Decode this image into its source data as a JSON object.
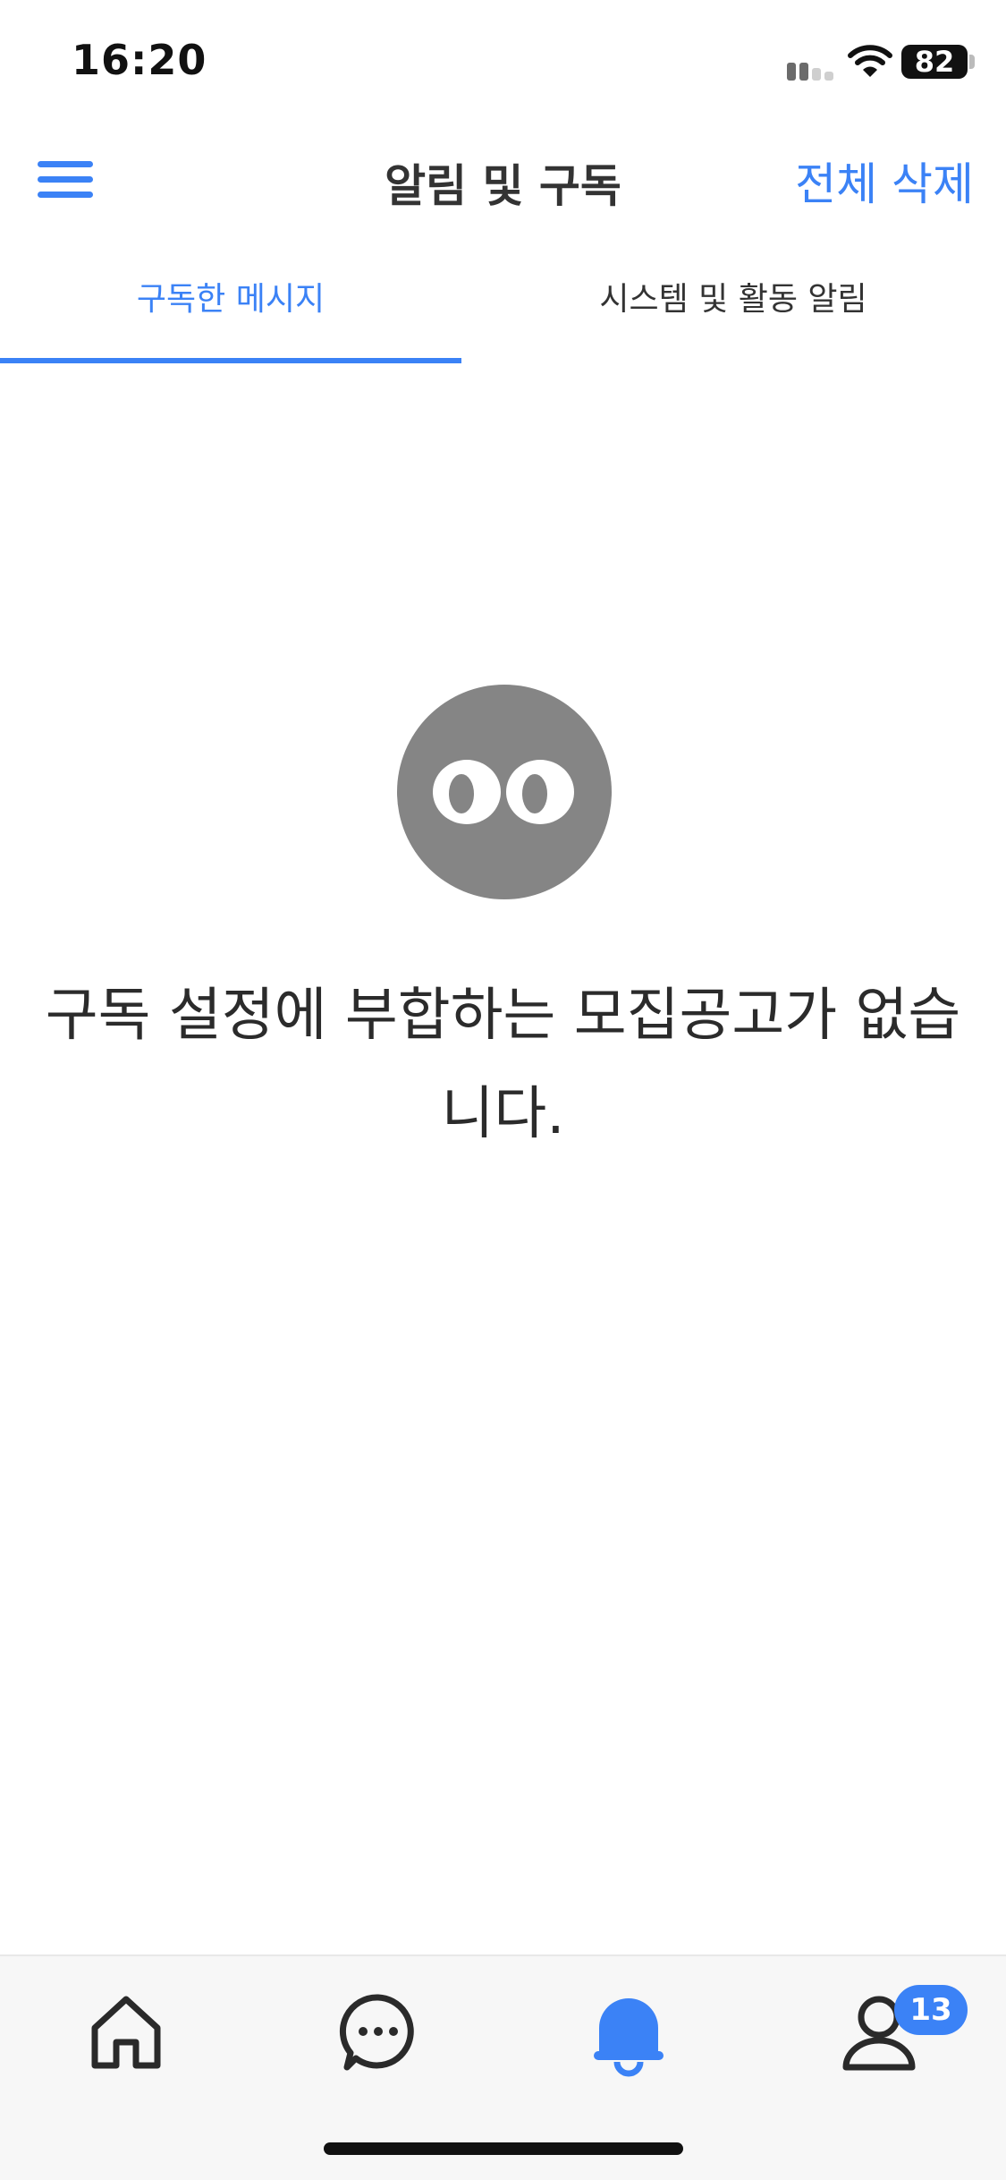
{
  "status_bar": {
    "time": "16:20",
    "battery_level": "82",
    "icons": [
      "signal-icon",
      "wifi-icon",
      "battery-icon"
    ]
  },
  "header": {
    "title": "알림 및 구독",
    "delete_all_label": "전체 삭제",
    "menu_icon": "hamburger-menu-icon"
  },
  "tabs": [
    {
      "label": "구독한 메시지",
      "selected": true
    },
    {
      "label": "시스템 및 활동 알림",
      "selected": false
    }
  ],
  "empty_state": {
    "icon": "eyes-face-icon",
    "message": "구독 설정에 부합하는 모집공고가 없습니다."
  },
  "bottom_nav": {
    "items": [
      {
        "icon": "home-icon",
        "active": false
      },
      {
        "icon": "chat-bubble-icon",
        "active": false
      },
      {
        "icon": "bell-icon",
        "active": true
      },
      {
        "icon": "profile-icon",
        "active": false
      }
    ],
    "profile_badge": "13"
  },
  "colors": {
    "accent": "#3b82f6",
    "text_primary": "#333333",
    "empty_icon": "#858585",
    "nav_background": "#f7f7f7"
  }
}
